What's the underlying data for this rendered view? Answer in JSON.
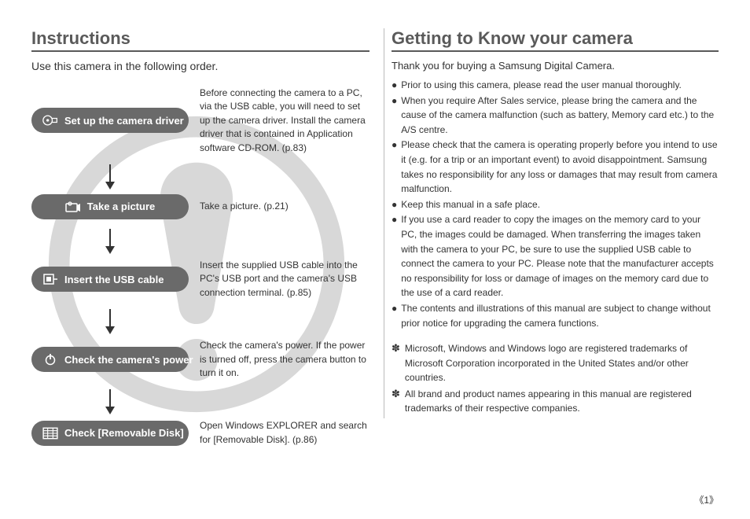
{
  "left": {
    "title": "Instructions",
    "subhead": "Use this camera in the following order.",
    "steps": [
      {
        "icon": "cd-icon",
        "label": "Set up the camera driver",
        "desc": "Before connecting the camera to a PC, via the USB cable, you will need to set up the camera driver. Install the camera driver that is contained in Application software CD-ROM. (p.83)"
      },
      {
        "icon": "camera-icon",
        "label": "Take a picture",
        "center": true,
        "desc": "Take a picture. (p.21)"
      },
      {
        "icon": "usb-icon",
        "label": "Insert the USB cable",
        "desc": "Insert the supplied USB cable into the PC's USB port and the camera's USB connection terminal. (p.85)"
      },
      {
        "icon": "power-icon",
        "label": "Check the camera's power",
        "desc": "Check the camera's power. If the power is turned off, press the camera button to turn it on."
      },
      {
        "icon": "disk-icon",
        "label": "Check [Removable Disk]",
        "desc": "Open Windows EXPLORER and search for [Removable Disk]. (p.86)"
      }
    ]
  },
  "right": {
    "title": "Getting to Know your camera",
    "intro": "Thank you for buying a Samsung Digital Camera.",
    "bullets": [
      "Prior to using this camera, please read the user manual thoroughly.",
      "When you require After Sales service, please bring the camera and the cause of the camera malfunction (such as battery, Memory card etc.) to the A/S centre.",
      "Please check that the camera is operating properly before you intend to use it (e.g. for a trip or an important event) to avoid disappointment. Samsung takes no responsibility for any loss or damages that may result from camera malfunction.",
      "Keep this manual in a safe place.",
      "If you use a card reader to copy the images on the memory card to your PC, the images could be damaged. When transferring the images taken with the camera to your PC, be sure to use the supplied USB cable to connect the camera to your PC. Please note that the manufacturer accepts no responsibility for loss or damage of images on the memory card due to the use of a card reader.",
      "The contents and illustrations of this manual are subject to change without prior notice for upgrading the camera functions."
    ],
    "notes": [
      "Microsoft, Windows and Windows logo are registered trademarks of Microsoft Corporation incorporated in the United States and/or other countries.",
      "All brand and product names appearing in this manual are registered trademarks of their respective companies."
    ]
  },
  "page_number": "《1》"
}
